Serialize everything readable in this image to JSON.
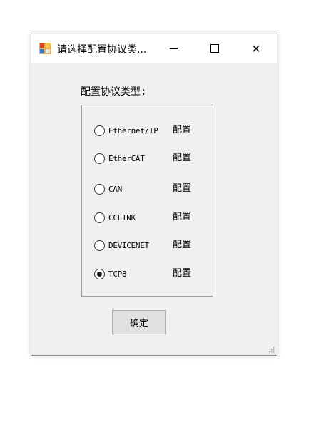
{
  "window": {
    "title": "请选择配置协议类...",
    "minimize_glyph": "",
    "close_glyph": "✕"
  },
  "group": {
    "label": "配置协议类型:"
  },
  "protocols": [
    {
      "label": "Ethernet/IP",
      "config": "配置",
      "checked": false
    },
    {
      "label": "EtherCAT",
      "config": "配置",
      "checked": false
    },
    {
      "label": "CAN",
      "config": "配置",
      "checked": false
    },
    {
      "label": "CCLINK",
      "config": "配置",
      "checked": false
    },
    {
      "label": "DEVICENET",
      "config": "配置",
      "checked": false
    },
    {
      "label": "TCP8",
      "config": "配置",
      "checked": true
    }
  ],
  "ok_button": {
    "label": "确定"
  }
}
